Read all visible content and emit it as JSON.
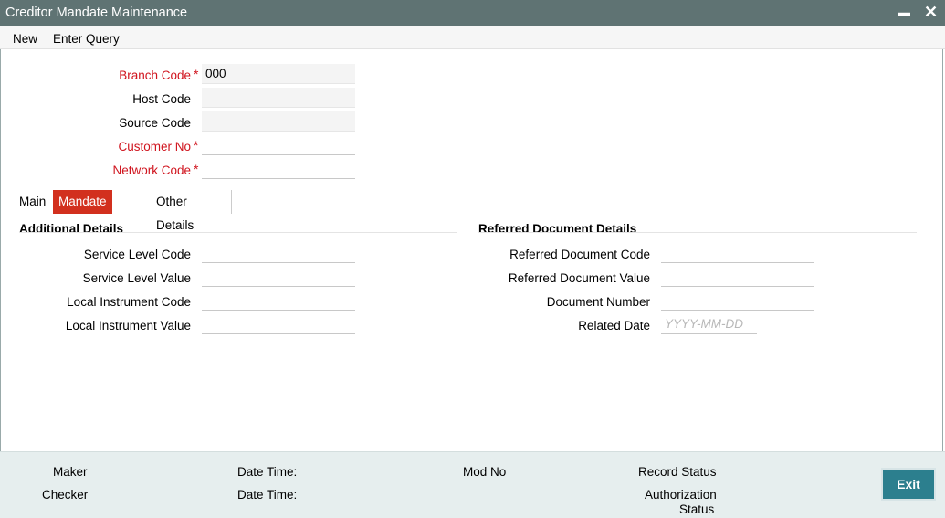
{
  "window": {
    "title": "Creditor Mandate Maintenance",
    "minimize_glyph": "▬",
    "close_glyph": "✕"
  },
  "menu": {
    "new_label": "New",
    "enter_query_label": "Enter Query"
  },
  "header_fields": {
    "branch_code": {
      "label": "Branch Code",
      "value": "000",
      "required": true
    },
    "host_code": {
      "label": "Host Code",
      "value": ""
    },
    "source_code": {
      "label": "Source Code",
      "value": ""
    },
    "customer_no": {
      "label": "Customer No",
      "value": "",
      "required": true
    },
    "network_code": {
      "label": "Network Code",
      "value": "",
      "required": true
    }
  },
  "required_marker": "*",
  "tabs": [
    {
      "label": "Main",
      "active": false
    },
    {
      "label": "Mandate Details",
      "active": true
    },
    {
      "label": "Other Details",
      "active": false
    }
  ],
  "additional_details": {
    "heading": "Additional Details",
    "service_level_code": {
      "label": "Service Level Code",
      "value": ""
    },
    "service_level_value": {
      "label": "Service Level Value",
      "value": ""
    },
    "local_instrument_code": {
      "label": "Local Instrument Code",
      "value": ""
    },
    "local_instrument_value": {
      "label": "Local Instrument Value",
      "value": ""
    }
  },
  "referred_document": {
    "heading": "Referred Document Details",
    "referred_document_code": {
      "label": "Referred Document Code",
      "value": ""
    },
    "referred_document_value": {
      "label": "Referred Document Value",
      "value": ""
    },
    "document_number": {
      "label": "Document Number",
      "value": ""
    },
    "related_date": {
      "label": "Related Date",
      "value": "",
      "placeholder": "YYYY-MM-DD"
    }
  },
  "footer": {
    "maker": "Maker",
    "checker": "Checker",
    "date_time_1": "Date Time:",
    "date_time_2": "Date Time:",
    "mod_no": "Mod No",
    "record_status": "Record Status",
    "authorization_status_line1": "Authorization",
    "authorization_status_line2": "Status",
    "exit_label": "Exit"
  },
  "colors": {
    "title_bar": "#5f7373",
    "required": "#d0141e",
    "active_tab": "#d2301e",
    "exit_button": "#2c7f8e",
    "footer_bg": "#e6eeee"
  }
}
